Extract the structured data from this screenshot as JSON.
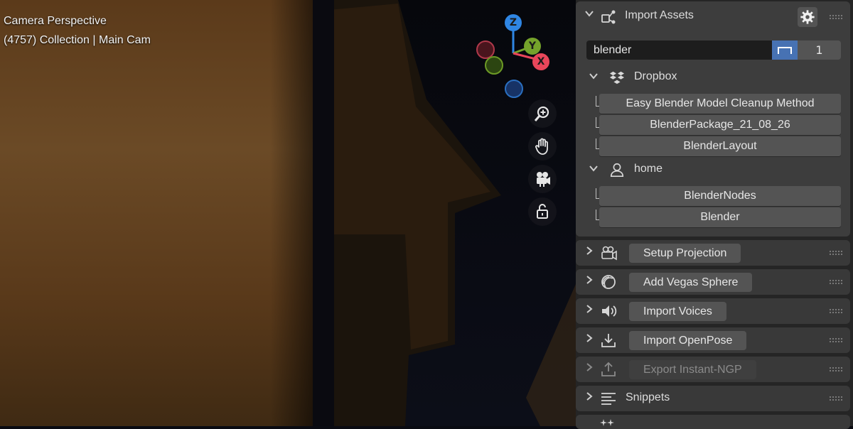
{
  "viewport": {
    "mode_label": "Camera Perspective",
    "collection_label": "(4757) Collection | Main Cam",
    "gizmo": {
      "z": "Z",
      "y": "Y",
      "x": "X"
    }
  },
  "import_assets": {
    "title": "Import Assets",
    "search_value": "blender",
    "count": "1",
    "groups": [
      {
        "label": "Dropbox",
        "icon": "dropbox-icon",
        "items": [
          "Easy Blender Model Cleanup Method",
          "BlenderPackage_21_08_26",
          "BlenderLayout"
        ]
      },
      {
        "label": "home",
        "icon": "user-icon",
        "items": [
          "BlenderNodes",
          "Blender"
        ]
      }
    ]
  },
  "panels": [
    {
      "label": "Setup Projection",
      "icon": "projector-icon",
      "disabled": false
    },
    {
      "label": "Add Vegas Sphere",
      "icon": "sphere-icon",
      "disabled": false
    },
    {
      "label": "Import Voices",
      "icon": "speaker-icon",
      "disabled": false
    },
    {
      "label": "Import OpenPose",
      "icon": "download-icon",
      "disabled": false
    },
    {
      "label": "Export Instant-NGP",
      "icon": "upload-icon",
      "disabled": true
    }
  ],
  "snippets": {
    "label": "Snippets"
  },
  "colors": {
    "accent": "#4772b3",
    "x_axis": "#e8465a",
    "y_axis": "#75a32b",
    "z_axis": "#2f86e4"
  }
}
